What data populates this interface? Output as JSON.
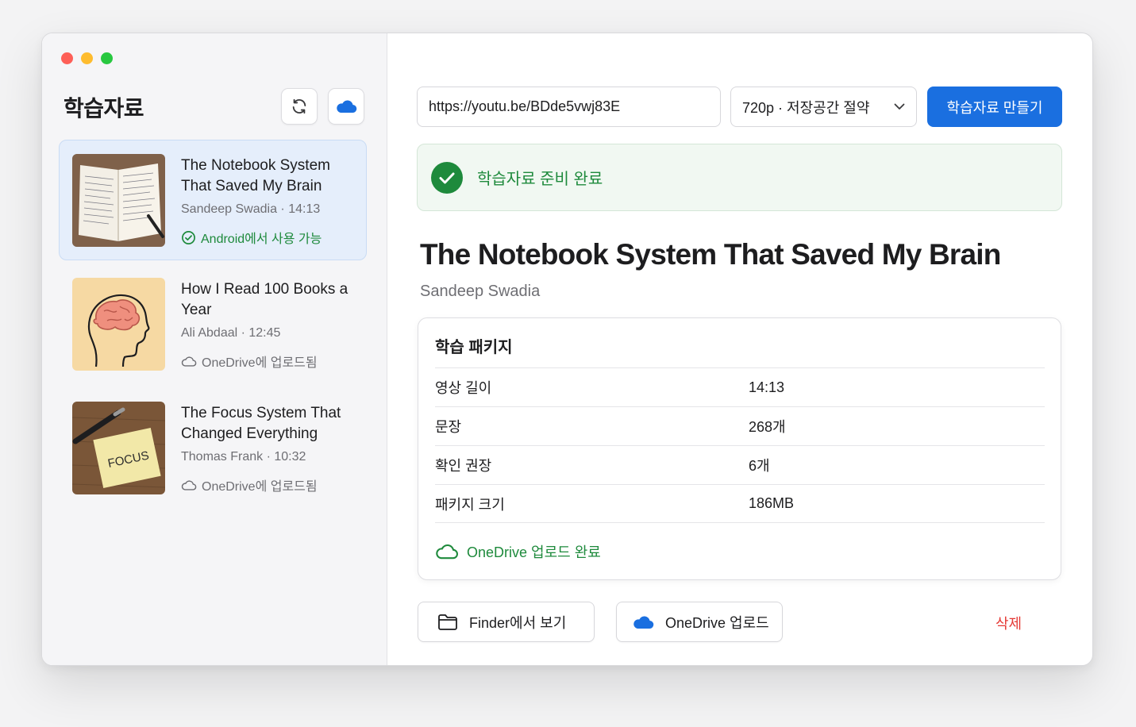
{
  "sidebar": {
    "title": "학습자료",
    "items": [
      {
        "title": "The Notebook System That Saved My Brain",
        "meta": "Sandeep Swadia · 14:13",
        "status": "Android에서 사용 가능",
        "status_icon": "check-circle-icon",
        "selected": true
      },
      {
        "title": "How I Read 100 Books a Year",
        "meta": "Ali Abdaal · 12:45",
        "status": "OneDrive에 업로드됨",
        "status_icon": "cloud-outline-icon",
        "selected": false
      },
      {
        "title": "The Focus System That Changed Everything",
        "meta": "Thomas Frank · 10:32",
        "status": "OneDrive에 업로드됨",
        "status_icon": "cloud-outline-icon",
        "selected": false,
        "thumb_text": "FOCUS"
      }
    ]
  },
  "toolbar": {
    "url_value": "https://youtu.be/BDde5vwj83E",
    "quality_value": "720p · 저장공간 절약",
    "make_label": "학습자료 만들기"
  },
  "banner": {
    "text": "학습자료 준비 완료"
  },
  "video": {
    "title": "The Notebook System That Saved My Brain",
    "channel": "Sandeep Swadia"
  },
  "package": {
    "title": "학습 패키지",
    "rows": [
      {
        "label": "영상 길이",
        "value": "14:13"
      },
      {
        "label": "문장",
        "value": "268개"
      },
      {
        "label": "확인 권장",
        "value": "6개"
      },
      {
        "label": "패키지 크기",
        "value": "186MB"
      }
    ],
    "footer": "OneDrive 업로드 완료"
  },
  "actions": {
    "finder_label": "Finder에서 보기",
    "onedrive_label": "OneDrive 업로드",
    "delete_label": "삭제"
  },
  "colors": {
    "accent": "#1a6fe0",
    "success": "#1e8a3c",
    "danger": "#e53935"
  }
}
